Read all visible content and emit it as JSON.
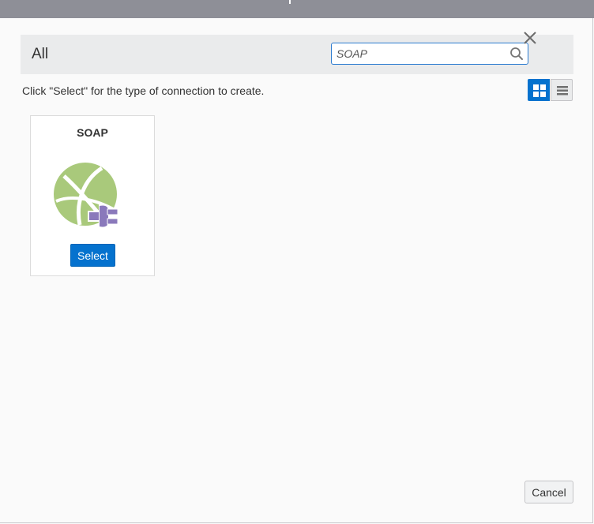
{
  "filter_bar": {
    "title": "All",
    "search": {
      "value": "SOAP",
      "placeholder": ""
    }
  },
  "instruction": "Click \"Select\" for the type of connection to create.",
  "view_toggle": {
    "active": "grid"
  },
  "connections": [
    {
      "name": "SOAP",
      "action_label": "Select",
      "icon": "soap-globe-plug-icon"
    }
  ],
  "footer": {
    "cancel_label": "Cancel"
  },
  "colors": {
    "accent": "#0572ce",
    "globe": "#a9c97b",
    "plug": "#8a79bb",
    "top_bar": "#8e8f97"
  }
}
